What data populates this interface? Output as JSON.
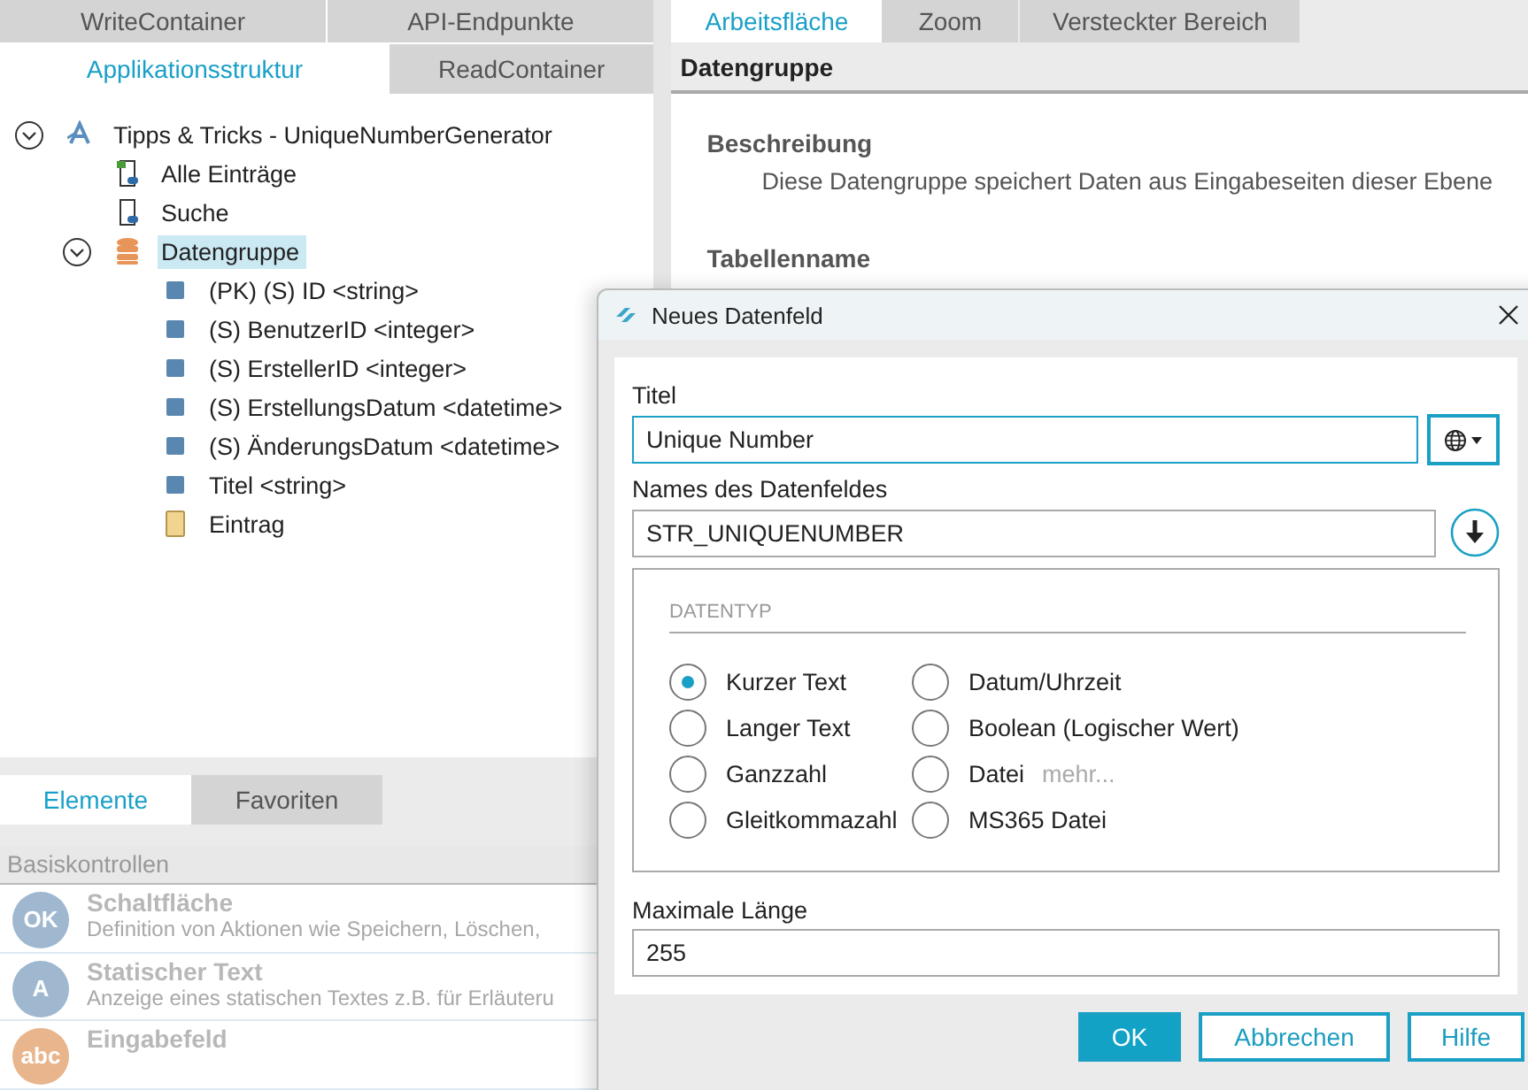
{
  "left_panel": {
    "tab_rows": [
      [
        {
          "label": "WriteContainer",
          "selected": false
        },
        {
          "label": "API-Endpunkte",
          "selected": false
        }
      ],
      [
        {
          "label": "Applikationsstruktur",
          "selected": true
        },
        {
          "label": "ReadContainer",
          "selected": false
        }
      ]
    ],
    "tree": [
      {
        "label": "Tipps & Tricks - UniqueNumberGenerator",
        "kind": "app",
        "expanded": true,
        "selected": false,
        "children": [
          {
            "label": "Alle Einträge",
            "kind": "start-page",
            "selected": false
          },
          {
            "label": "Suche",
            "kind": "page",
            "selected": false
          },
          {
            "label": "Datengruppe",
            "kind": "database",
            "expanded": true,
            "selected": true,
            "children": [
              {
                "label": "(PK) (S) ID <string>",
                "kind": "field",
                "selected": false
              },
              {
                "label": "(S) BenutzerID <integer>",
                "kind": "field",
                "selected": false
              },
              {
                "label": "(S) ErstellerID <integer>",
                "kind": "field",
                "selected": false
              },
              {
                "label": "(S) ErstellungsDatum <datetime>",
                "kind": "field",
                "selected": false
              },
              {
                "label": "(S) ÄnderungsDatum <datetime>",
                "kind": "field",
                "selected": false
              },
              {
                "label": "Titel <string>",
                "kind": "field",
                "selected": false
              },
              {
                "label": "Eintrag",
                "kind": "entry",
                "selected": false
              }
            ]
          }
        ]
      }
    ]
  },
  "toolbox": {
    "tabs": [
      {
        "label": "Elemente",
        "selected": true
      },
      {
        "label": "Favoriten",
        "selected": false
      }
    ],
    "section": "Basiskontrollen",
    "items": [
      {
        "title": "Schaltfläche",
        "description": "Definition von Aktionen wie Speichern, Löschen,",
        "icon_text": "OK",
        "color": "#9fb8cf"
      },
      {
        "title": "Statischer Text",
        "description": "Anzeige eines statischen Textes z.B. für Erläuteru",
        "icon_text": "A",
        "color": "#9fb8cf"
      },
      {
        "title": "Eingabefeld",
        "icon_text": "abc",
        "color": "#e8b58c"
      }
    ]
  },
  "workspace": {
    "tabs": [
      {
        "label": "Arbeitsfläche",
        "selected": true
      },
      {
        "label": "Zoom",
        "selected": false
      },
      {
        "label": "Versteckter Bereich",
        "selected": false
      }
    ],
    "header": "Datengruppe",
    "sections": [
      {
        "heading": "Beschreibung",
        "text": "Diese Datengruppe speichert Daten aus Eingabeseiten dieser Ebene"
      },
      {
        "heading": "Tabellenname"
      }
    ]
  },
  "dialog": {
    "title": "Neues Datenfeld",
    "title_field": {
      "label": "Titel",
      "value": "Unique Number"
    },
    "name_field": {
      "label": "Names des Datenfeldes",
      "value": "STR_UNIQUENUMBER"
    },
    "datatype": {
      "legend": "DATENTYP",
      "options": [
        {
          "label": "Kurzer Text",
          "selected": true
        },
        {
          "label": "Langer Text",
          "selected": false
        },
        {
          "label": "Ganzzahl",
          "selected": false
        },
        {
          "label": "Gleitkommazahl",
          "selected": false
        },
        {
          "label": "Datum/Uhrzeit",
          "selected": false
        },
        {
          "label": "Boolean (Logischer Wert)",
          "selected": false
        },
        {
          "label": "Datei",
          "selected": false,
          "link": "mehr..."
        },
        {
          "label": "MS365 Datei",
          "selected": false
        }
      ]
    },
    "max_length": {
      "label": "Maximale Länge",
      "value": "255"
    },
    "buttons": [
      {
        "label": "OK",
        "primary": true
      },
      {
        "label": "Abbrechen",
        "primary": false
      },
      {
        "label": "Hilfe",
        "primary": false
      }
    ]
  }
}
